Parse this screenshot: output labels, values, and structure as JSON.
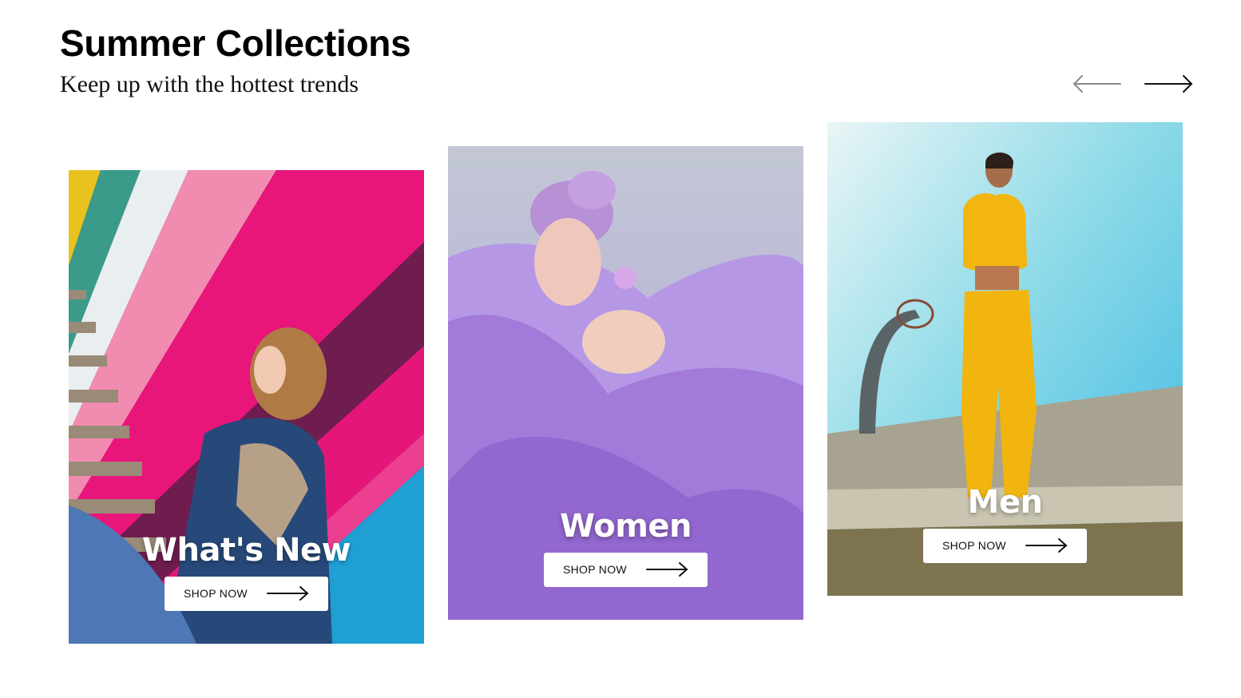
{
  "header": {
    "title": "Summer Collections",
    "subtitle": "Keep up with the hottest trends"
  },
  "carousel": {
    "prev_icon": "arrow-left-icon",
    "next_icon": "arrow-right-icon",
    "prev_color": "#8a8a8a",
    "next_color": "#111111"
  },
  "cards": [
    {
      "label": "What's New",
      "button_label": "SHOP NOW",
      "button_icon": "arrow-right-icon"
    },
    {
      "label": "Women",
      "button_label": "SHOP NOW",
      "button_icon": "arrow-right-icon"
    },
    {
      "label": "Men",
      "button_label": "SHOP NOW",
      "button_icon": "arrow-right-icon"
    }
  ]
}
